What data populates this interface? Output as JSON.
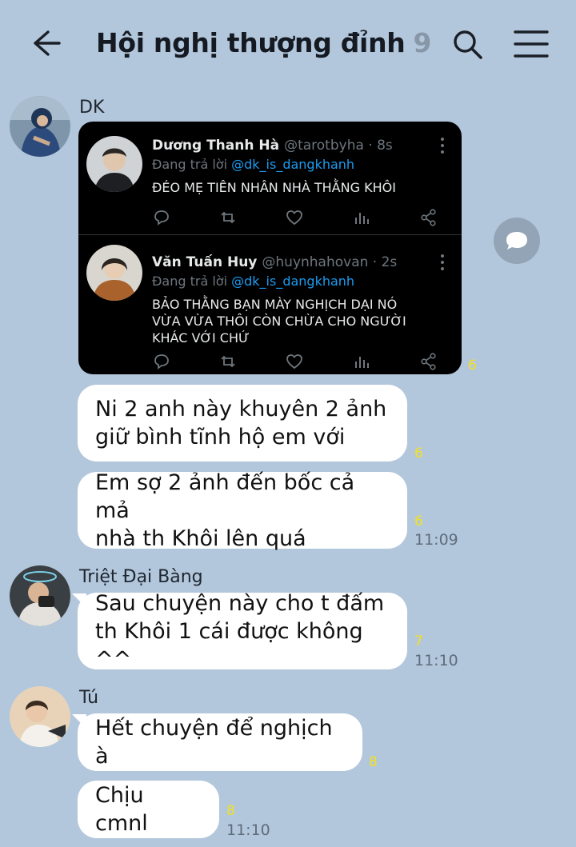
{
  "header": {
    "title": "Hội nghị thượng đỉnh",
    "member_count": "9"
  },
  "messages": [
    {
      "sender": "DK",
      "tweets": [
        {
          "name": "Dương Thanh Hà",
          "handle": "@tarotbyha · 8s",
          "reply_prefix": "Đang trả lời",
          "reply_to": "@dk_is_dangkhanh",
          "text": "ĐÉO MẸ TIÊN NHÂN NHÀ THẰNG KHÔI"
        },
        {
          "name": "Văn Tuấn Huy",
          "handle": "@huynhahovan · 2s",
          "reply_prefix": "Đang trả lời",
          "reply_to": "@dk_is_dangkhanh",
          "text": "BẢO THẰNG BẠN MÀY NGHỊCH DẠI NÓ\nVỪA VỪA THÔI CÒN CHỪA CHO NGƯỜI\nKHÁC VỚI CHỨ"
        }
      ],
      "image_unread": "6",
      "bubbles": [
        {
          "text": "Ni 2 anh này khuyên 2 ảnh\ngiữ bình tĩnh hộ em với",
          "unread": "6"
        },
        {
          "text": "Em sợ 2 ảnh đến bốc cả mả\nnhà th Khôi lên quá",
          "unread": "6",
          "time": "11:09"
        }
      ]
    },
    {
      "sender": "Triệt Đại Bàng",
      "bubbles": [
        {
          "text": "Sau chuyện này cho t đấm\nth Khôi 1 cái được không ^^",
          "unread": "7",
          "time": "11:10"
        }
      ]
    },
    {
      "sender": "Tú",
      "bubbles": [
        {
          "text": "Hết chuyện để nghịch à",
          "unread": "8"
        },
        {
          "text": "Chịu cmnl",
          "unread": "8",
          "time": "11:10"
        }
      ]
    }
  ]
}
